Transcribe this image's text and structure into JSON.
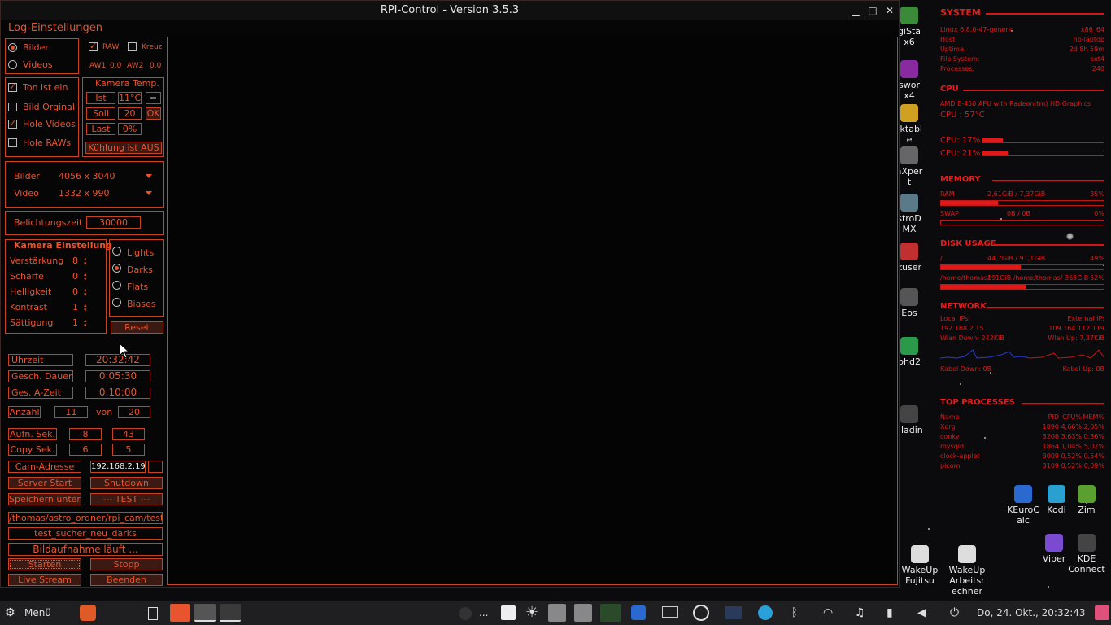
{
  "window": {
    "title": "RPI-Control - Version 3.5.3",
    "minimize": "▁",
    "maximize": "□",
    "close": "✕"
  },
  "app": {
    "heading": "Log-Einstellungen",
    "media": {
      "bilder": "Bilder",
      "videos": "Videos",
      "selected": "Bilder"
    },
    "raw_label": "RAW",
    "raw_checked": true,
    "kreuz_label": "Kreuz",
    "kreuz_checked": false,
    "aw1_label": "AW1",
    "aw1_value": "0.0",
    "aw2_label": "AW2",
    "aw2_value": "0.0",
    "options": [
      {
        "label": "Ton ist ein",
        "checked": true
      },
      {
        "label": "Bild Orginal",
        "checked": false
      },
      {
        "label": "Hole Videos",
        "checked": true
      },
      {
        "label": "Hole RAWs",
        "checked": false
      }
    ],
    "temp": {
      "title": "Kamera Temp.",
      "ist_label": "Ist",
      "ist_value": "11°C",
      "eq": "=",
      "soll_label": "Soll",
      "soll_value": "20",
      "ok": "OK",
      "last_label": "Last",
      "last_value": "0%",
      "cooling": "Kühlung ist AUS"
    },
    "res": {
      "bilder_label": "Bilder",
      "bilder_value": "4056 x 3040",
      "video_label": "Video",
      "video_value": "1332 x 990"
    },
    "exposure": {
      "label": "Belichtungszeit :",
      "value": "30000"
    },
    "camera": {
      "title": "Kamera Einstellung",
      "rows": [
        {
          "label": "Verstärkung",
          "value": "8"
        },
        {
          "label": "Schärfe",
          "value": "0"
        },
        {
          "label": "Helligkeit",
          "value": "0"
        },
        {
          "label": "Kontrast",
          "value": "1"
        },
        {
          "label": "Sättigung",
          "value": "1"
        }
      ]
    },
    "frametype": {
      "options": [
        "Lights",
        "Darks",
        "Flats",
        "Biases"
      ],
      "selected": "Darks",
      "reset": "Reset"
    },
    "status": {
      "uhrzeit_label": "Uhrzeit",
      "uhrzeit_value": "20:32:42",
      "dauer_label": "Gesch. Dauer",
      "dauer_value": "0:05:30",
      "azeit_label": "Ges. A-Zeit",
      "azeit_value": "0:10:00",
      "anzahl_label": "Anzahl",
      "anzahl_value": "11",
      "von_label": "von",
      "von_value": "20",
      "aufn_label": "Aufn. Sek.",
      "aufn_a": "8",
      "aufn_b": "43",
      "copy_label": "Copy Sek.",
      "copy_a": "6",
      "copy_b": "5"
    },
    "cam": {
      "label": "Cam-Adresse",
      "address": "192.168.2.19"
    },
    "buttons": {
      "server_start": "Server Start",
      "shutdown": "Shutdown",
      "save_under": "Speichern unter..",
      "test": "--- TEST ---",
      "start": "Starten",
      "stop": "Stopp",
      "live": "Live Stream",
      "quit": "Beenden"
    },
    "path": "/thomas/astro_ordner/rpi_cam/test_s",
    "folder": "test_sucher_neu_darks",
    "running": "Bildaufnahme läuft ..."
  },
  "conky": {
    "system_h": "SYSTEM",
    "os": "Linux 6.8.0-47-generic",
    "arch": "x86_64",
    "host_l": "Host:",
    "host_v": "hp-laptop",
    "uptime_l": "Uptime:",
    "uptime_v": "2d 8h 59m",
    "fs_l": "File System:",
    "fs_v": "ext4",
    "proc_l": "Processes:",
    "proc_v": "240",
    "cpu_h": "CPU",
    "cpu_model": "AMD E-450 APU with Radeon(tm) HD Graphics",
    "cpu_temp": "CPU :  57°C",
    "cpu1": "CPU:  17%",
    "cpu1_pct": 17,
    "cpu2": "CPU:  21%",
    "cpu2_pct": 21,
    "mem_h": "MEMORY",
    "ram_l": "RAM",
    "ram_v": "2,61GiB / 7,37GiB",
    "ram_p": "35%",
    "ram_pct": 35,
    "swap_l": "SWAP",
    "swap_v": "0B / 0B",
    "swap_p": "0%",
    "swap_pct": 0,
    "disk_h": "DISK USAGE",
    "d1_l": "/",
    "d1_v": "44,7GiB / 91,1GiB",
    "d1_p": "49%",
    "d1_pct": 49,
    "d2_l": "/home/thomas/",
    "d2_v": "191GiB /home/thomas/ 365GiB",
    "d2_p": "52%",
    "d2_pct": 52,
    "net_h": "NETWORK",
    "lip_l": "Local IPs:",
    "eip_l": "External IP:",
    "lip_v": "192.168.2.15",
    "eip_v": "109.164.112.119",
    "wdown": "Wlan Down: 242KiB",
    "wup": "Wlan Up: 7,37KiB",
    "kdown": "Kabel Down: 0B",
    "kup": "Kabel Up: 0B",
    "top_h": "TOP PROCESSES",
    "top_cols": [
      "Name",
      "PID",
      "CPU%",
      "MEM%"
    ],
    "top": [
      [
        "Xorg",
        "1890",
        "4,66%",
        "2,05%"
      ],
      [
        "conky",
        "3206",
        "3,63%",
        "0,36%"
      ],
      [
        "mysqld",
        "1864",
        "1,04%",
        "5,02%"
      ],
      [
        "clock-applet",
        "3009",
        "0,52%",
        "0,54%"
      ],
      [
        "picom",
        "3109",
        "0,52%",
        "0,09%"
      ]
    ]
  },
  "desktop": {
    "left_icons": [
      {
        "label": "giSta\nx6",
        "color": "#3a8a3a"
      },
      {
        "label": "swor\nx4",
        "color": "#8a2aa0"
      },
      {
        "label": "rktabl\ne",
        "color": "#d0a020"
      },
      {
        "label": "aXper\nt",
        "color": "#666"
      },
      {
        "label": "stroD\nMX",
        "color": "#5a7a8a"
      },
      {
        "label": "kuser",
        "color": "#c03030"
      },
      {
        "label": "Eos",
        "color": "#555"
      },
      {
        "label": "phd2",
        "color": "#2a9a4a"
      },
      {
        "label": "aladin",
        "color": "#444"
      }
    ],
    "right_icons": [
      {
        "label": "KEuroC\nalc",
        "color": "#2a6ad0"
      },
      {
        "label": "Kodi",
        "color": "#2aa0d0"
      },
      {
        "label": "Zim",
        "color": "#5aa030"
      },
      {
        "label": "Viber",
        "color": "#7a4ad0"
      },
      {
        "label": "KDE\nConnect",
        "color": "#444"
      },
      {
        "label": "WakeUp\nFujitsu",
        "color": "#ddd"
      },
      {
        "label": "WakeUp\nArbeitsr\nechner",
        "color": "#ddd"
      }
    ]
  },
  "taskbar": {
    "menu": "Menü",
    "clock": "Do, 24. Okt., 20:32:43",
    "ellipsis": "..."
  }
}
